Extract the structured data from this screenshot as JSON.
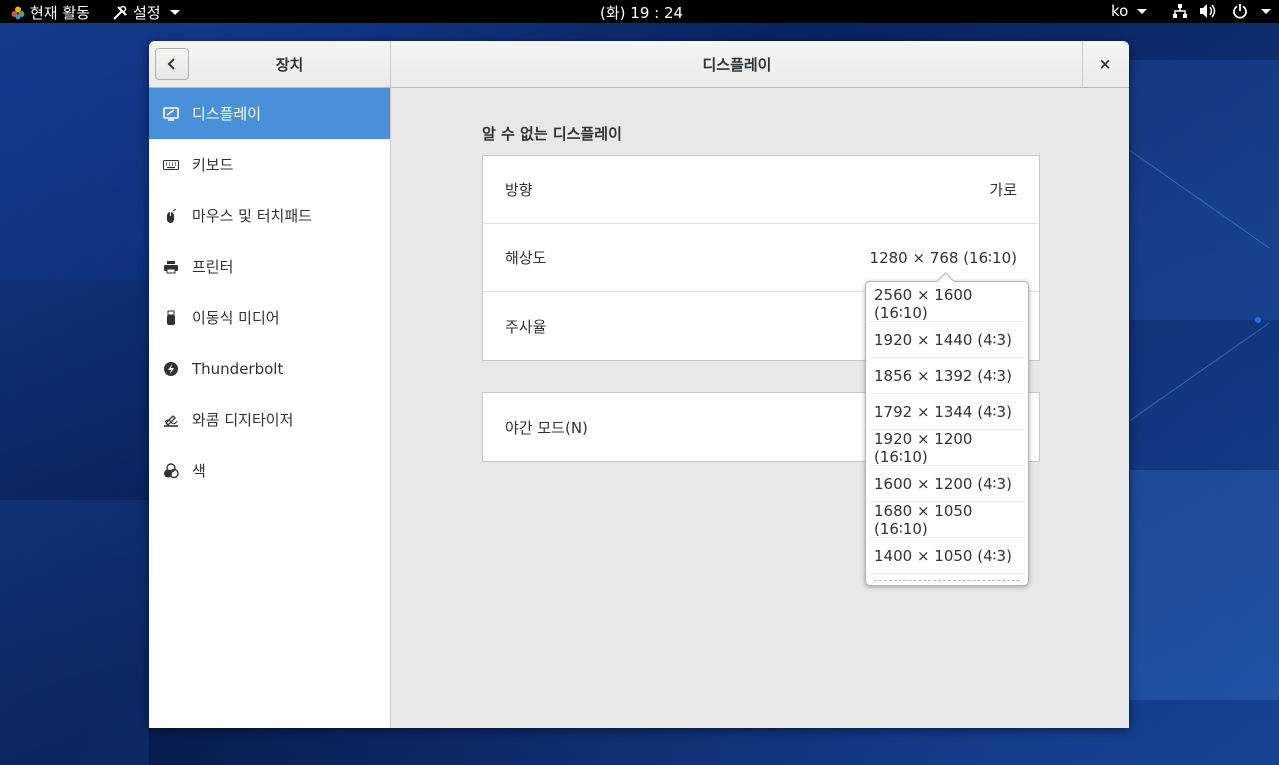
{
  "topbar": {
    "activities": "현재 활동",
    "app_menu": "설정",
    "clock": "(화) 19 : 24",
    "lang": "ko"
  },
  "window": {
    "sidebar_title": "장치",
    "title": "디스플레이",
    "close": "×"
  },
  "sidebar": {
    "items": [
      {
        "label": "디스플레이",
        "icon": "display-icon"
      },
      {
        "label": "키보드",
        "icon": "keyboard-icon"
      },
      {
        "label": "마우스 및 터치패드",
        "icon": "mouse-icon"
      },
      {
        "label": "프린터",
        "icon": "printer-icon"
      },
      {
        "label": "이동식 미디어",
        "icon": "usb-icon"
      },
      {
        "label": "Thunderbolt",
        "icon": "thunderbolt-icon"
      },
      {
        "label": "와콤 디지타이저",
        "icon": "tablet-icon"
      },
      {
        "label": "색",
        "icon": "color-icon"
      }
    ]
  },
  "display": {
    "section_title": "알 수 없는 디스플레이",
    "orientation_label": "방향",
    "orientation_value": "가로",
    "resolution_label": "해상도",
    "resolution_value": "1280 × 768 (16∶10)",
    "refresh_label": "주사율",
    "night_mode_label": "야간 모드(N)"
  },
  "resolution_options": [
    "2560 × 1600 (16∶10)",
    "1920 × 1440 (4∶3)",
    "1856 × 1392 (4∶3)",
    "1792 × 1344 (4∶3)",
    "1920 × 1200 (16∶10)",
    "1600 × 1200 (4∶3)",
    "1680 × 1050 (16∶10)",
    "1400 × 1050 (4∶3)"
  ],
  "colors": {
    "accent": "#4a90d9",
    "topbar": "#000000"
  }
}
